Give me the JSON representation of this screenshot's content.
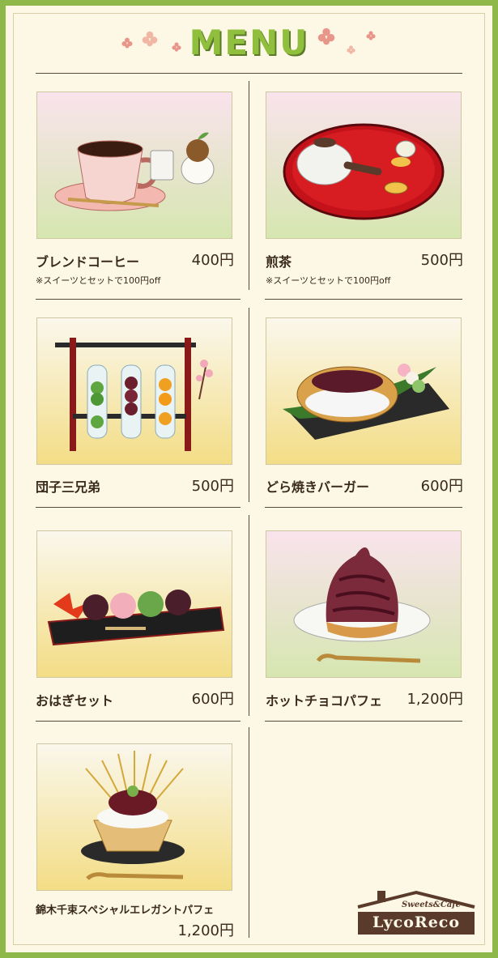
{
  "header": {
    "title": "MENU"
  },
  "items": [
    {
      "name": "ブレンドコーヒー",
      "price": "400円",
      "note": "※スイーツとセットで100円off"
    },
    {
      "name": "煎茶",
      "price": "500円",
      "note": "※スイーツとセットで100円off"
    },
    {
      "name": "団子三兄弟",
      "price": "500円"
    },
    {
      "name": "どら焼きバーガー",
      "price": "600円"
    },
    {
      "name": "おはぎセット",
      "price": "600円"
    },
    {
      "name": "ホットチョコパフェ",
      "price": "1,200円"
    },
    {
      "name": "錦木千束スペシャルエレガントパフェ",
      "price": "1,200円"
    }
  ],
  "logo": {
    "subtitle": "Sweets&Cafe",
    "name": "LycoReco"
  },
  "icons": [
    "flower-petal-icon",
    "coffee-cup-icon",
    "tea-pot-icon",
    "dango-icon",
    "dorayaki-icon",
    "ohagi-icon",
    "parfait-icon"
  ],
  "colors": {
    "accent": "#8fb84a",
    "background": "#fdf8e6",
    "text": "#3a2a1c",
    "logo": "#5a3a2a"
  }
}
